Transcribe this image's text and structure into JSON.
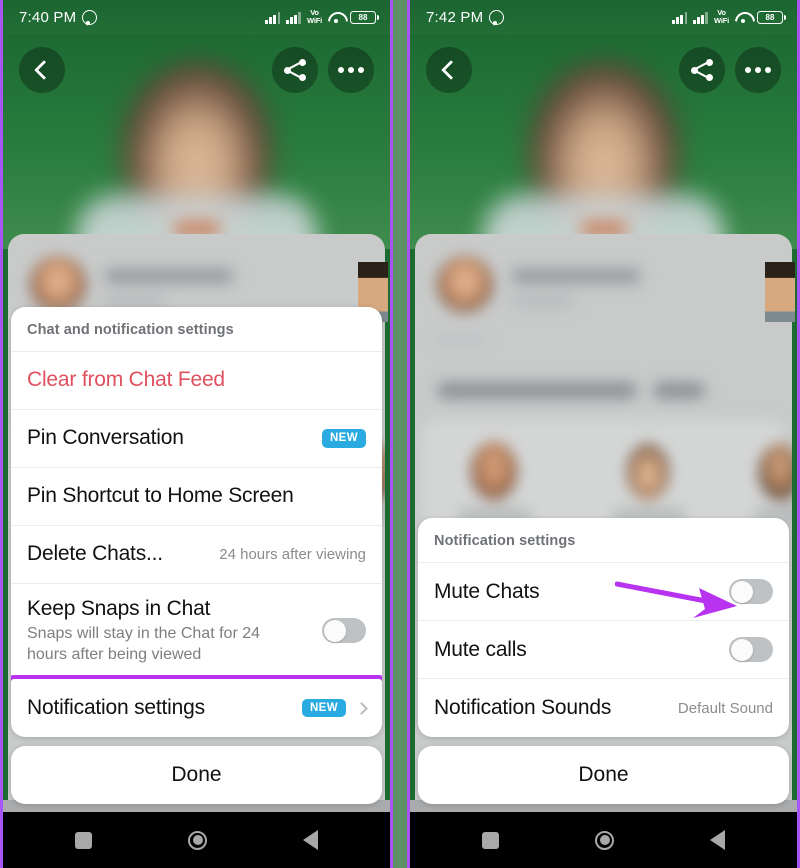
{
  "phones": [
    {
      "id": "left-phone",
      "status_bar": {
        "time": "7:40 PM",
        "app_icon": "whatsapp-icon",
        "network_label": "Vo WiFi",
        "vo_line1": "Vo",
        "vo_line2": "WiFi",
        "battery_level": "88"
      },
      "header": {
        "back_icon": "back-chevron-icon",
        "share_icon": "share-icon",
        "more_icon": "more-options-icon"
      },
      "sheet": {
        "title": "Chat and notification settings",
        "rows": [
          {
            "label": "Clear from Chat Feed",
            "style": "danger"
          },
          {
            "label": "Pin Conversation",
            "badge": "NEW"
          },
          {
            "label": "Pin Shortcut to Home Screen"
          },
          {
            "label": "Delete Chats...",
            "value": "24 hours after viewing"
          },
          {
            "label": "Keep Snaps in Chat",
            "sub": "Snaps will stay in the Chat for 24 hours after being viewed",
            "toggle": "off"
          },
          {
            "label": "Notification settings",
            "badge": "NEW",
            "chevron": true,
            "highlighted": true
          }
        ]
      },
      "done_label": "Done"
    },
    {
      "id": "right-phone",
      "status_bar": {
        "time": "7:42 PM",
        "app_icon": "whatsapp-icon",
        "network_label": "Vo WiFi",
        "vo_line1": "Vo",
        "vo_line2": "WiFi",
        "battery_level": "88"
      },
      "header": {
        "back_icon": "back-chevron-icon",
        "share_icon": "share-icon",
        "more_icon": "more-options-icon"
      },
      "sheet": {
        "title": "Notification settings",
        "rows": [
          {
            "label": "Mute Chats",
            "toggle": "off",
            "annotated": true
          },
          {
            "label": "Mute calls",
            "toggle": "off"
          },
          {
            "label": "Notification Sounds",
            "value": "Default Sound"
          }
        ]
      },
      "done_label": "Done"
    }
  ],
  "annotations": {
    "highlight_color": "#b833f0",
    "arrow_color": "#b833f0",
    "badge_color": "#29abe2",
    "danger_color": "#e0515f",
    "frame_border_color": "#a855f7"
  },
  "nav_bar": {
    "recents_icon": "square-icon",
    "home_icon": "circle-icon",
    "back_icon": "triangle-back-icon"
  }
}
